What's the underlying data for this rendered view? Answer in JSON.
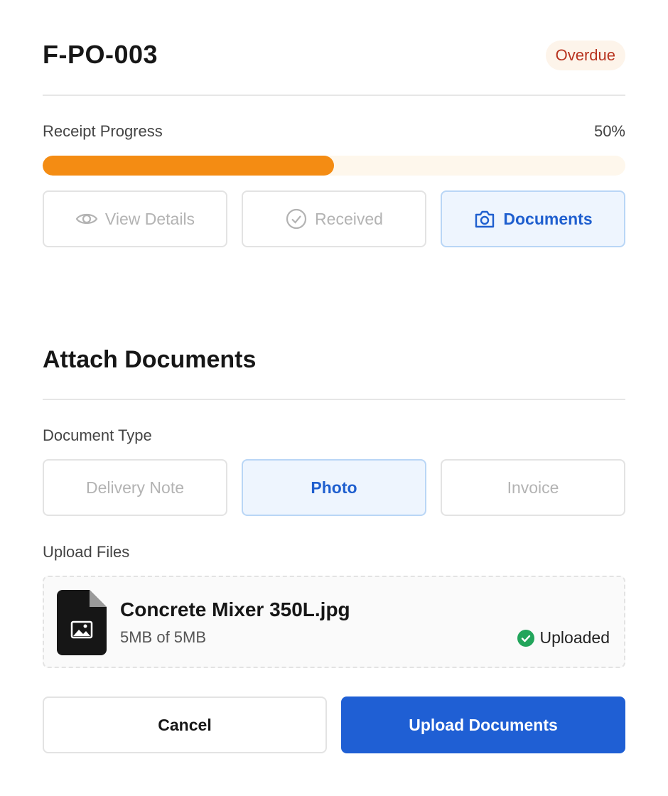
{
  "order": {
    "id": "F-PO-003",
    "status": "Overdue"
  },
  "progress": {
    "label": "Receipt Progress",
    "percent_text": "50%",
    "value": 0.5
  },
  "tabs": [
    {
      "label": "View Details",
      "icon": "eye-icon",
      "active": false
    },
    {
      "label": "Received",
      "icon": "check-circle-icon",
      "active": false
    },
    {
      "label": "Documents",
      "icon": "camera-icon",
      "active": true
    }
  ],
  "attach": {
    "title": "Attach Documents",
    "type_label": "Document Type",
    "types": [
      {
        "label": "Delivery Note",
        "active": false
      },
      {
        "label": "Photo",
        "active": true
      },
      {
        "label": "Invoice",
        "active": false
      }
    ],
    "upload_label": "Upload Files",
    "file": {
      "name": "Concrete Mixer 350L.jpg",
      "size": "5MB of 5MB",
      "status": "Uploaded",
      "icon": "image-file-icon"
    }
  },
  "actions": {
    "cancel": "Cancel",
    "upload": "Upload Documents"
  },
  "colors": {
    "accent": "#1f5fd4",
    "progress": "#f48c13",
    "overdue": "#b8331e",
    "success": "#22a55b"
  }
}
